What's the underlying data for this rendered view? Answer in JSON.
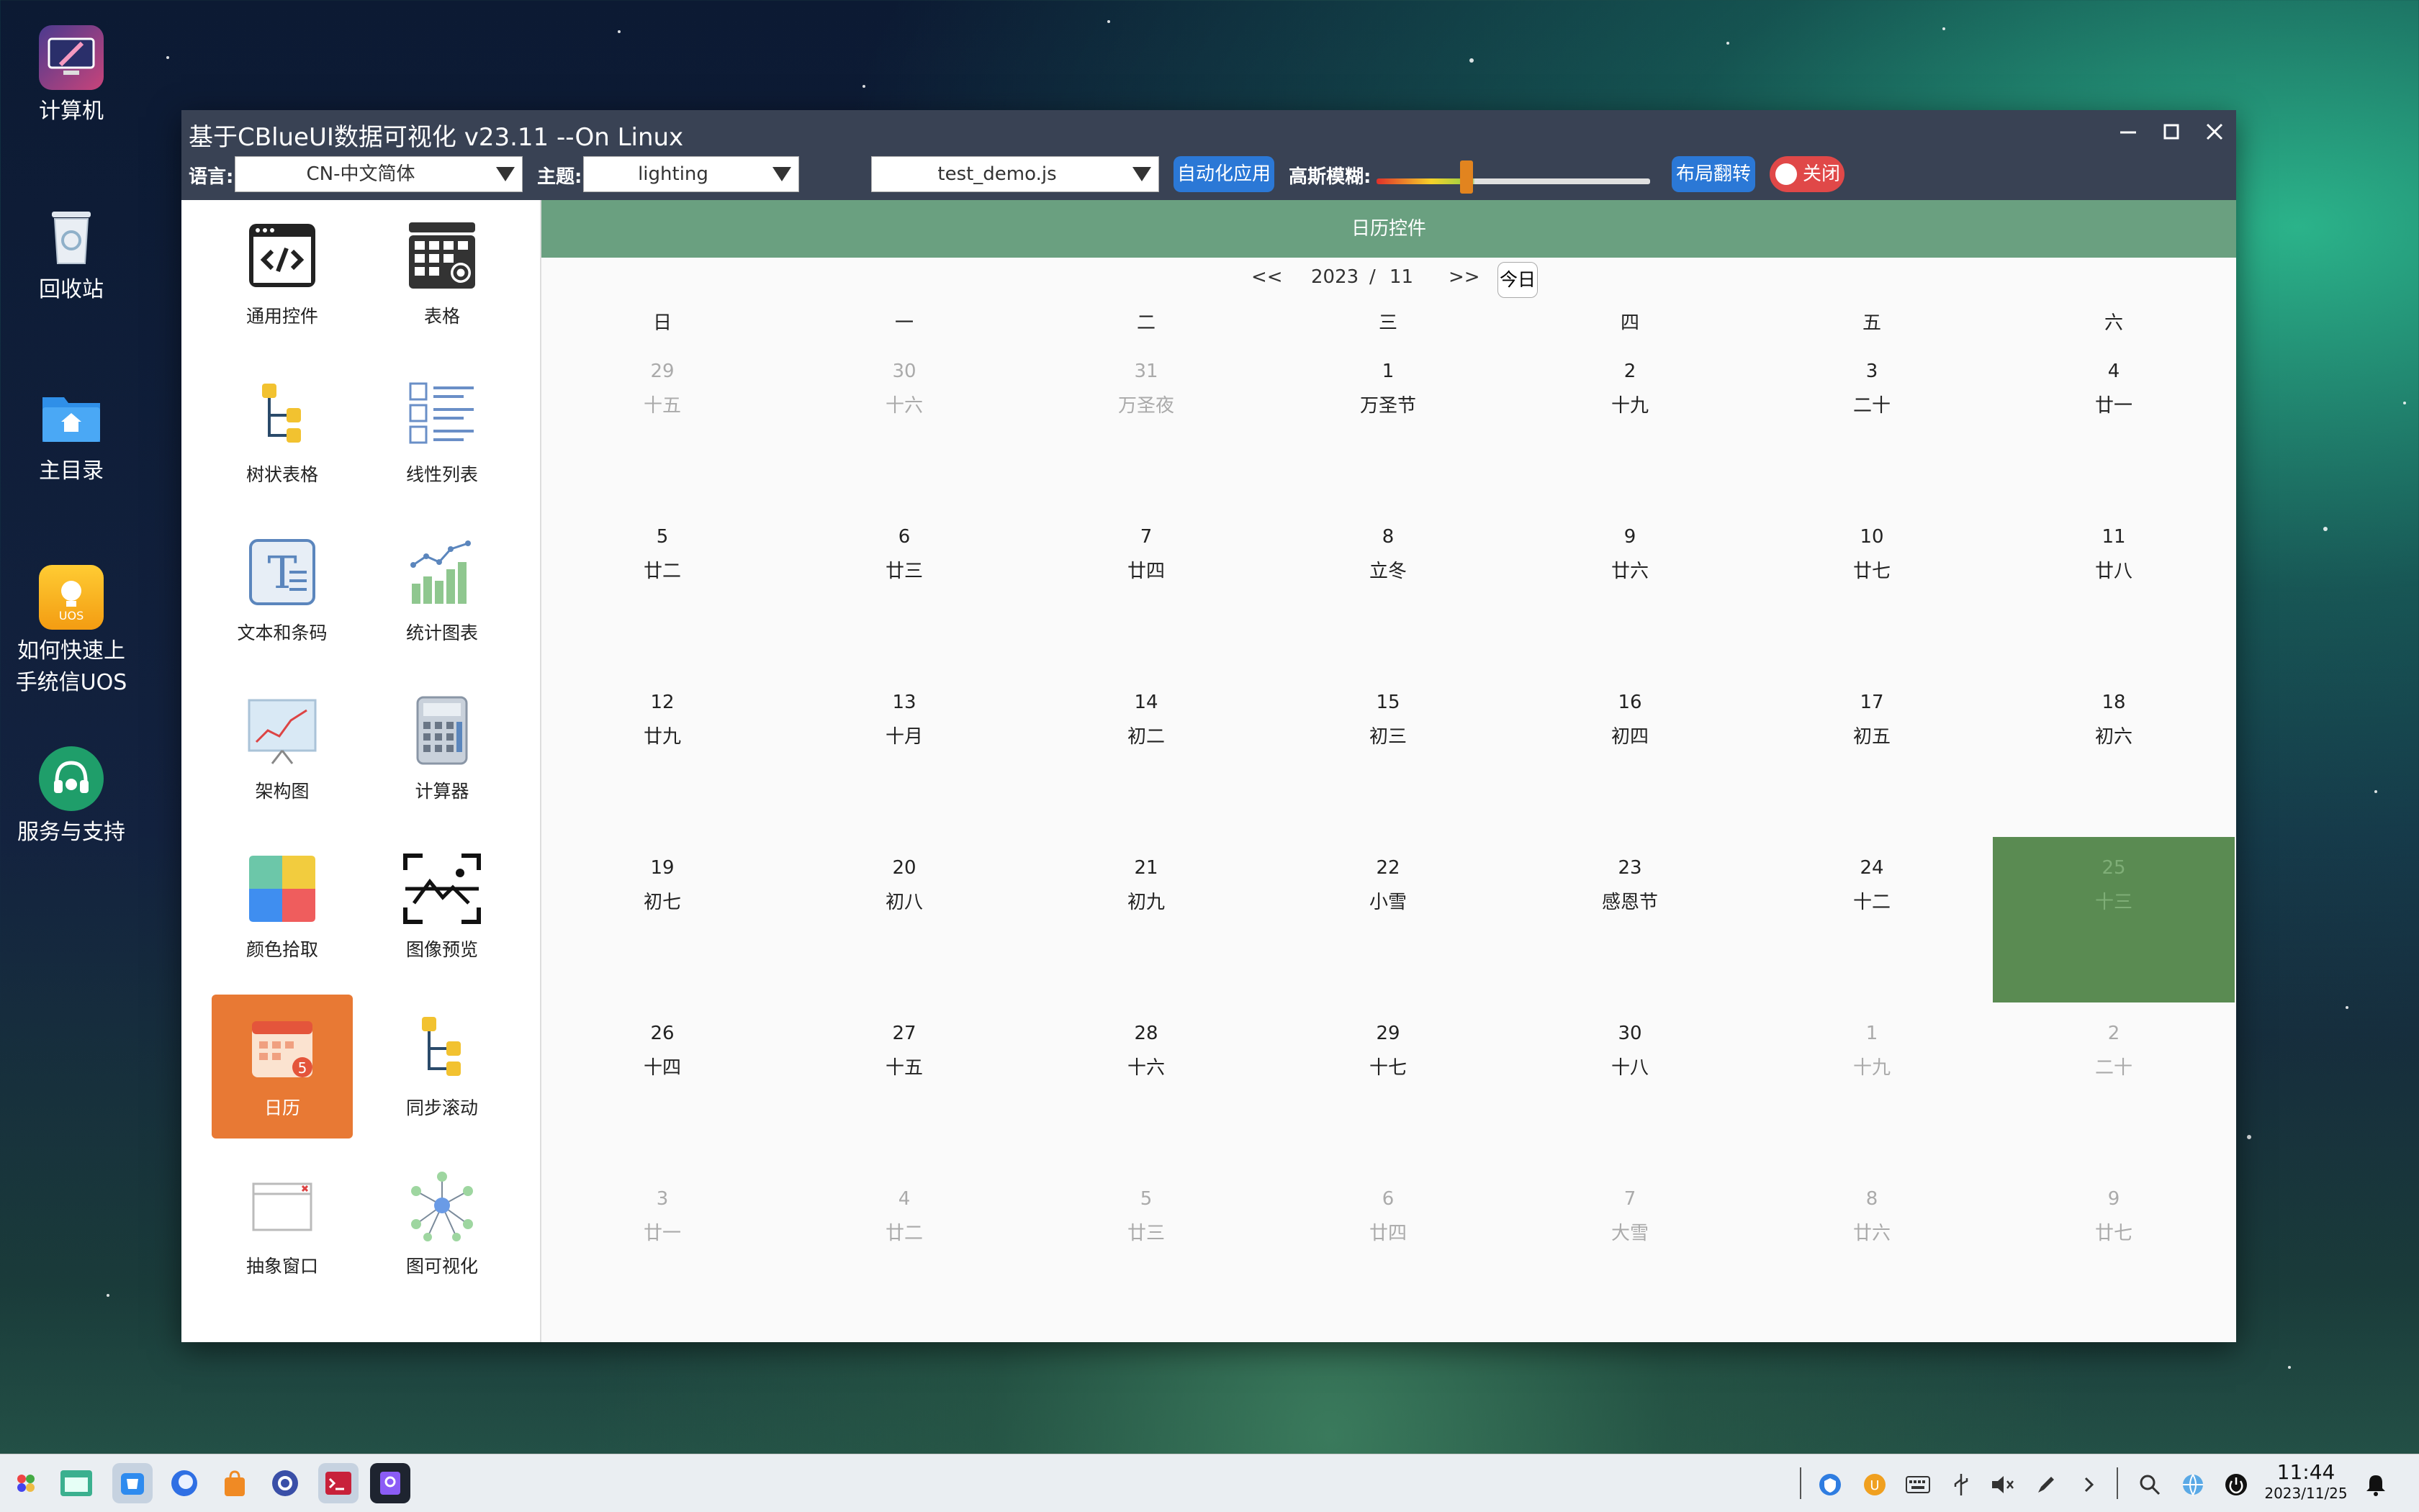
{
  "desktop": {
    "icons": [
      {
        "label": "计算机"
      },
      {
        "label": "回收站"
      },
      {
        "label": "主目录"
      },
      {
        "label": "如何快速上手统信UOS",
        "badge": "UOS"
      },
      {
        "label": "服务与支持"
      }
    ]
  },
  "window": {
    "title": "基于CBlueUI数据可视化 v23.11 --On Linux",
    "toolbar": {
      "lang_label": "语言:",
      "lang_value": "CN-中文简体",
      "theme_label": "主题:",
      "theme_value": "lighting",
      "script_value": "test_demo.js",
      "auto_apply": "自动化应用",
      "blur_label": "高斯模糊:",
      "blur_level_percent": 33,
      "flip_layout": "布局翻转",
      "close_toggle": "关闭"
    }
  },
  "sidebar": {
    "items": [
      {
        "label": "通用控件",
        "icon": "code-window-icon"
      },
      {
        "label": "表格",
        "icon": "table-gear-icon"
      },
      {
        "label": "树状表格",
        "icon": "tree-table-icon"
      },
      {
        "label": "线性列表",
        "icon": "linear-list-icon"
      },
      {
        "label": "文本和条码",
        "icon": "text-barcode-icon"
      },
      {
        "label": "统计图表",
        "icon": "statistics-chart-icon"
      },
      {
        "label": "架构图",
        "icon": "architecture-chart-icon"
      },
      {
        "label": "计算器",
        "icon": "calculator-icon"
      },
      {
        "label": "颜色拾取",
        "icon": "color-picker-icon"
      },
      {
        "label": "图像预览",
        "icon": "image-preview-icon"
      },
      {
        "label": "日历",
        "icon": "calendar-icon",
        "active": true
      },
      {
        "label": "同步滚动",
        "icon": "sync-scroll-icon"
      },
      {
        "label": "抽象窗口",
        "icon": "abstract-window-icon"
      },
      {
        "label": "图可视化",
        "icon": "graph-visualization-icon"
      }
    ]
  },
  "calendar": {
    "header": "日历控件",
    "prev": "<<",
    "year": "2023",
    "sep": "/",
    "month": "11",
    "next": ">>",
    "today": "今日",
    "weekdays": [
      "日",
      "一",
      "二",
      "三",
      "四",
      "五",
      "六"
    ],
    "days": [
      {
        "n": "29",
        "l": "十五",
        "other": true
      },
      {
        "n": "30",
        "l": "十六",
        "other": true
      },
      {
        "n": "31",
        "l": "万圣夜",
        "other": true
      },
      {
        "n": "1",
        "l": "万圣节"
      },
      {
        "n": "2",
        "l": "十九"
      },
      {
        "n": "3",
        "l": "二十"
      },
      {
        "n": "4",
        "l": "廿一"
      },
      {
        "n": "5",
        "l": "廿二"
      },
      {
        "n": "6",
        "l": "廿三"
      },
      {
        "n": "7",
        "l": "廿四"
      },
      {
        "n": "8",
        "l": "立冬"
      },
      {
        "n": "9",
        "l": "廿六"
      },
      {
        "n": "10",
        "l": "廿七"
      },
      {
        "n": "11",
        "l": "廿八"
      },
      {
        "n": "12",
        "l": "廿九"
      },
      {
        "n": "13",
        "l": "十月"
      },
      {
        "n": "14",
        "l": "初二"
      },
      {
        "n": "15",
        "l": "初三"
      },
      {
        "n": "16",
        "l": "初四"
      },
      {
        "n": "17",
        "l": "初五"
      },
      {
        "n": "18",
        "l": "初六"
      },
      {
        "n": "19",
        "l": "初七"
      },
      {
        "n": "20",
        "l": "初八"
      },
      {
        "n": "21",
        "l": "初九"
      },
      {
        "n": "22",
        "l": "小雪"
      },
      {
        "n": "23",
        "l": "感恩节"
      },
      {
        "n": "24",
        "l": "十二"
      },
      {
        "n": "25",
        "l": "十三",
        "selected": true
      },
      {
        "n": "26",
        "l": "十四"
      },
      {
        "n": "27",
        "l": "十五"
      },
      {
        "n": "28",
        "l": "十六"
      },
      {
        "n": "29",
        "l": "十七"
      },
      {
        "n": "30",
        "l": "十八"
      },
      {
        "n": "1",
        "l": "十九",
        "other": true
      },
      {
        "n": "2",
        "l": "二十",
        "other": true
      },
      {
        "n": "3",
        "l": "廿一",
        "other": true
      },
      {
        "n": "4",
        "l": "廿二",
        "other": true
      },
      {
        "n": "5",
        "l": "廿三",
        "other": true
      },
      {
        "n": "6",
        "l": "廿四",
        "other": true
      },
      {
        "n": "7",
        "l": "大雪",
        "other": true
      },
      {
        "n": "8",
        "l": "廿六",
        "other": true
      },
      {
        "n": "9",
        "l": "廿七",
        "other": true
      }
    ]
  },
  "taskbar": {
    "time": "11:44",
    "date": "2023/11/25"
  }
}
